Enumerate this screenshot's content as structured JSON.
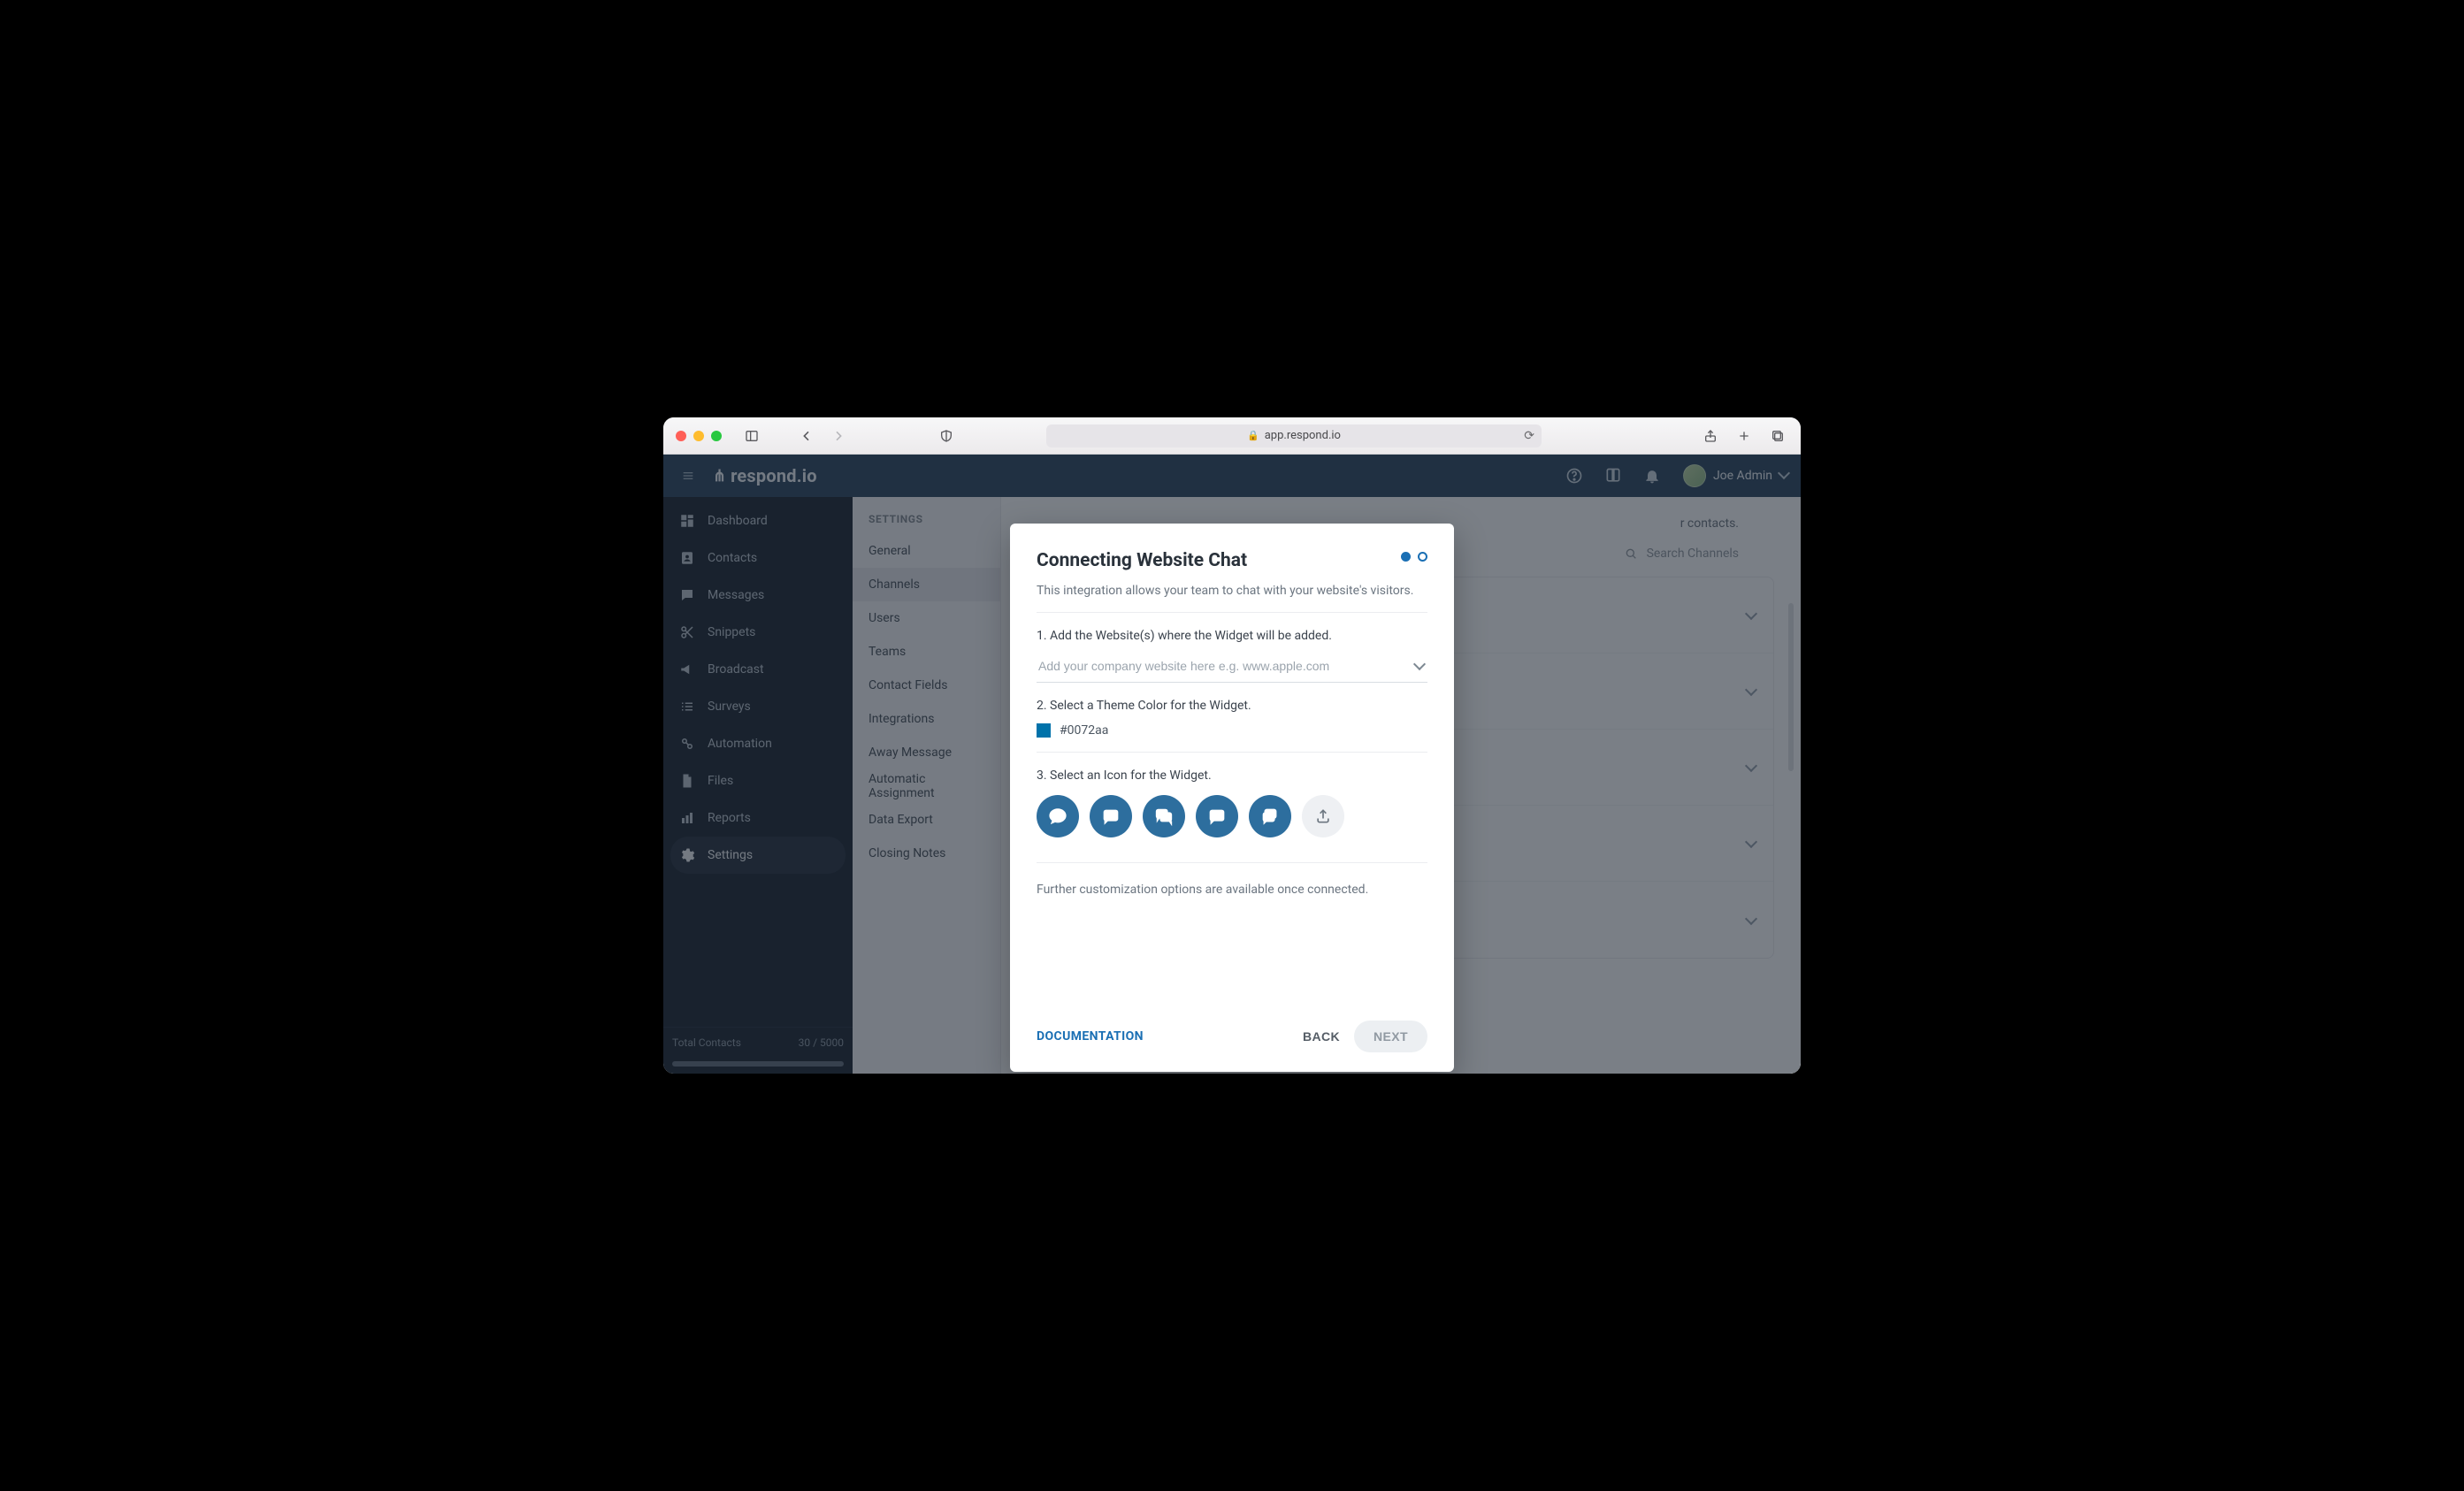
{
  "browser": {
    "url_host": "app.respond.io"
  },
  "topbar": {
    "brand": "respond.io",
    "user_name": "Joe Admin"
  },
  "sidebar": {
    "items": [
      {
        "label": "Dashboard"
      },
      {
        "label": "Contacts"
      },
      {
        "label": "Messages"
      },
      {
        "label": "Snippets"
      },
      {
        "label": "Broadcast"
      },
      {
        "label": "Surveys"
      },
      {
        "label": "Automation"
      },
      {
        "label": "Files"
      },
      {
        "label": "Reports"
      },
      {
        "label": "Settings"
      }
    ],
    "footer_label": "Total Contacts",
    "footer_value": "30 / 5000"
  },
  "settings_nav": {
    "heading": "SETTINGS",
    "items": [
      "General",
      "Channels",
      "Users",
      "Teams",
      "Contact Fields",
      "Integrations",
      "Away Message",
      "Automatic Assignment",
      "Data Export",
      "Closing Notes"
    ]
  },
  "main": {
    "hint_suffix": "r contacts.",
    "search_placeholder": "Search Channels"
  },
  "modal": {
    "title": "Connecting Website Chat",
    "description": "This integration allows your team to chat with your website's visitors.",
    "step1_label": "1. Add the Website(s) where the Widget will be added.",
    "step1_placeholder": "Add your company website here e.g. www.apple.com",
    "step2_label": "2. Select a Theme Color for the Widget.",
    "theme_color": "#0072aa",
    "step3_label": "3. Select an Icon for the Widget.",
    "note": "Further customization options are available once connected.",
    "documentation_label": "DOCUMENTATION",
    "back_label": "BACK",
    "next_label": "NEXT"
  }
}
